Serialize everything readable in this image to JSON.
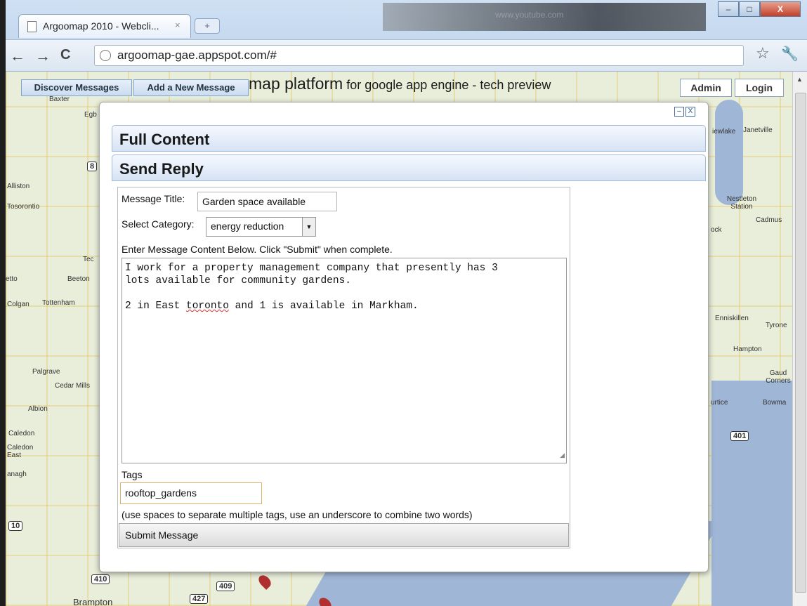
{
  "browser": {
    "tab_title": "Argoomap 2010 - Webcli...",
    "tab_close": "×",
    "new_tab": "+",
    "back": "←",
    "forward": "→",
    "reload": "C",
    "url": "argoomap-gae.appspot.com/#",
    "blurred_url": "www.youtube.com",
    "star": "☆",
    "wrench": "🔧",
    "min": "–",
    "max": "□",
    "close": "X"
  },
  "app": {
    "nav_tabs": [
      "Discover Messages",
      "Add a New Message"
    ],
    "title_main": "map platform",
    "title_sub": " for google app engine - tech preview",
    "admin_label": "Admin",
    "login_label": "Login"
  },
  "popup": {
    "minimize": "–",
    "close": "X",
    "section_full": "Full Content",
    "section_reply": "Send Reply",
    "form": {
      "title_label": "Message Title:",
      "title_value": "Garden space available",
      "category_label": "Select Category:",
      "category_value": "energy reduction",
      "content_instructions": "Enter Message Content Below. Click \"Submit\" when complete.",
      "content_line1": "I work for a property management company that presently has 3",
      "content_line2": "lots available for community gardens.",
      "content_line3_a": "2 in East ",
      "content_line3_b": "toronto",
      "content_line3_c": " and 1 is available in Markham.",
      "tags_label": "Tags",
      "tags_value": "rooftop_gardens",
      "tags_hint": "(use spaces to separate multiple tags, use an underscore to combine two words)",
      "submit_label": "Submit Message"
    }
  },
  "map": {
    "labels": [
      "Baxter",
      "Egb",
      "Alliston",
      "Tosorontio",
      "Tec",
      "Beeton",
      "etto",
      "Colgan",
      "Tottenham",
      "Palgrave",
      "Cedar Mills",
      "Albion",
      "Caledon",
      "Caledon East",
      "anagh",
      "Brampton",
      "iewlake",
      "Janetville",
      "Nestleton Station",
      "Cadmus",
      "ock",
      "Enniskillen",
      "Tyrone",
      "Hampton",
      "Gaud Corners",
      "urtice",
      "Bowma"
    ],
    "highways": [
      "8",
      "10",
      "410",
      "427",
      "409",
      "401"
    ]
  },
  "colors": {
    "accent": "#7ea3cf",
    "map_water": "#9fb6d6",
    "map_land": "#e8eed9"
  }
}
